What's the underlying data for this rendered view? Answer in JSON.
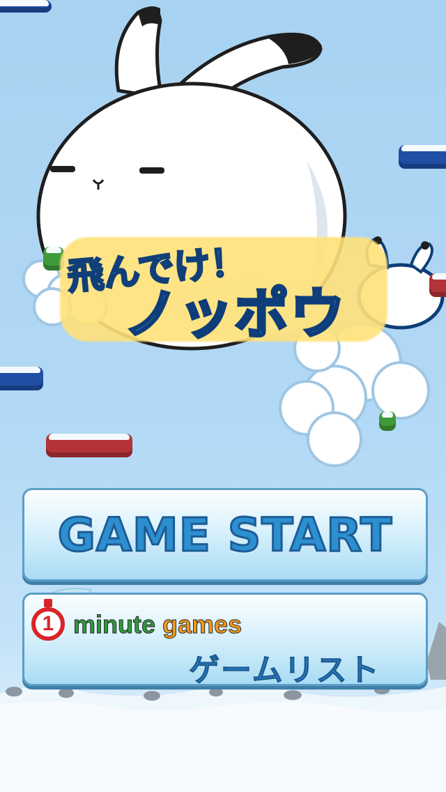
{
  "title": {
    "line1": "飛んでけ！",
    "line2": "ノッポウ"
  },
  "buttons": {
    "start_label": "GAME START",
    "list_badge_number": "1",
    "list_brand_word1": "minute",
    "list_brand_word2": "games",
    "list_label": "ゲームリスト"
  },
  "colors": {
    "sky": "#a8d2f2",
    "platform_blue": "#1f4ea4",
    "platform_red": "#b23338",
    "accent_blue": "#2d8fd0",
    "brand_green": "#2f9a3c",
    "brand_orange": "#f29a1d",
    "stopwatch_red": "#d9252a"
  }
}
